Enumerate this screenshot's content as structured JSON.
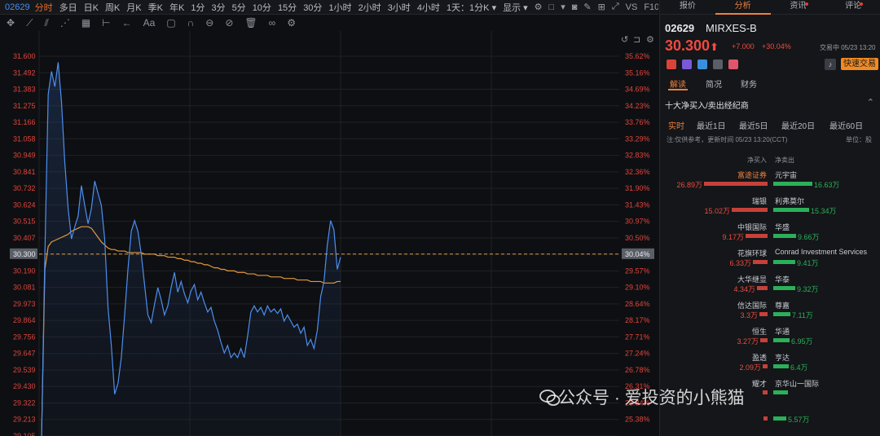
{
  "toolbar": {
    "code": "02629",
    "timeframes": [
      "分时",
      "多日",
      "日K",
      "周K",
      "月K",
      "季K",
      "年K",
      "1分",
      "3分",
      "5分",
      "10分",
      "15分",
      "30分",
      "1小时",
      "2小时",
      "3小时",
      "4小时"
    ],
    "active_timeframe": "分时",
    "dropdown": "1天：1分K",
    "display": "显示",
    "vs_label": "VS",
    "f10_label": "F10"
  },
  "drawbar": {
    "text_tool": "Aa"
  },
  "chart_data": {
    "type": "line",
    "price_ticks": [
      "31.600",
      "31.492",
      "31.383",
      "31.275",
      "31.166",
      "31.058",
      "30.949",
      "30.841",
      "30.732",
      "30.624",
      "30.515",
      "30.407",
      "30.300",
      "30.190",
      "30.081",
      "29.973",
      "29.864",
      "29.756",
      "29.647",
      "29.539",
      "29.430",
      "29.322",
      "29.213",
      "29.105"
    ],
    "pct_ticks": [
      "35.62%",
      "35.16%",
      "34.69%",
      "34.23%",
      "33.76%",
      "33.29%",
      "32.83%",
      "32.36%",
      "31.90%",
      "31.43%",
      "30.97%",
      "30.50%",
      "30.04%",
      "29.57%",
      "29.10%",
      "28.64%",
      "28.17%",
      "27.71%",
      "27.24%",
      "26.78%",
      "26.31%",
      "25.84%",
      "25.38%"
    ],
    "current_price": 30.3,
    "current_pct": "30.04%",
    "ylim": [
      29.105,
      31.6
    ],
    "series": [
      {
        "values": [
          29.1,
          30.3,
          31.35,
          31.5,
          31.4,
          31.56,
          31.3,
          30.9,
          30.6,
          30.4,
          30.48,
          30.55,
          30.75,
          30.62,
          30.5,
          30.6,
          30.78,
          30.7,
          30.62,
          30.4,
          29.95,
          29.7,
          29.38,
          29.45,
          29.62,
          29.9,
          30.2,
          30.45,
          30.52,
          30.45,
          30.3,
          30.1,
          29.9,
          29.85,
          29.97,
          30.08,
          30.0,
          29.9,
          29.96,
          30.08,
          30.18,
          30.05,
          30.12,
          30.04,
          29.98,
          30.06,
          30.1,
          30.0,
          30.05,
          29.98,
          29.92,
          29.95,
          29.86,
          29.8,
          29.72,
          29.65,
          29.7,
          29.62,
          29.65,
          29.62,
          29.68,
          29.62,
          29.76,
          29.92,
          29.96,
          29.92,
          29.95,
          29.9,
          29.96,
          29.92,
          29.94,
          29.91,
          29.94,
          29.86,
          29.9,
          29.86,
          29.82,
          29.84,
          29.78,
          29.82,
          29.7,
          29.74,
          29.68,
          29.8,
          30.02,
          30.12,
          30.36,
          30.52,
          30.46,
          30.2,
          30.28
        ]
      },
      {
        "values": [
          29.1,
          30.2,
          30.35,
          30.38,
          30.39,
          30.4,
          30.41,
          30.42,
          30.43,
          30.45,
          30.46,
          30.47,
          30.48,
          30.48,
          30.48,
          30.47,
          30.44,
          30.41,
          30.38,
          30.36,
          30.34,
          30.33,
          30.33,
          30.32,
          30.32,
          30.32,
          30.31,
          30.31,
          30.31,
          30.31,
          30.31,
          30.3,
          30.3,
          30.3,
          30.3,
          30.29,
          30.29,
          30.29,
          30.28,
          30.28,
          30.28,
          30.27,
          30.27,
          30.26,
          30.26,
          30.25,
          30.25,
          30.24,
          30.24,
          30.23,
          30.23,
          30.22,
          30.21,
          30.21,
          30.2,
          30.2,
          30.19,
          30.19,
          30.19,
          30.18,
          30.18,
          30.18,
          30.17,
          30.17,
          30.17,
          30.16,
          30.16,
          30.16,
          30.16,
          30.15,
          30.15,
          30.15,
          30.15,
          30.14,
          30.14,
          30.14,
          30.14,
          30.13,
          30.13,
          30.13,
          30.13,
          30.12,
          30.12,
          30.12,
          30.12,
          30.11,
          30.11,
          30.11,
          30.11,
          30.12,
          30.12
        ]
      }
    ]
  },
  "right_panel": {
    "tabs": [
      {
        "label": "报价",
        "active": false,
        "dot": false
      },
      {
        "label": "分析",
        "active": true,
        "dot": false
      },
      {
        "label": "资讯",
        "active": false,
        "dot": true
      },
      {
        "label": "评论",
        "active": false,
        "dot": true
      }
    ],
    "code": "02629",
    "name": "MIRXES-B",
    "price": "30.300",
    "arrow": "⬆",
    "change": "+7.000",
    "change_pct": "+30.04%",
    "status": "交易中 05/23 13:20",
    "quick_trade": "快速交易",
    "subtabs": [
      "解读",
      "简况",
      "财务"
    ],
    "section_title": "十大净买入/卖出经纪商",
    "periods": [
      "实时",
      "最近1日",
      "最近5日",
      "最近20日",
      "最近60日"
    ],
    "note": "注:仅供参考，更新时间 05/23 13:20(CCT)",
    "unit": "单位：股",
    "col_buy": "净买入",
    "col_sell": "净卖出",
    "brokers": [
      {
        "buy_name": "富途证券",
        "buy_val": "26.89万",
        "buy": 26.89,
        "sell_name": "元宇宙",
        "sell_val": "16.63万",
        "sell": 16.63,
        "highlight": true
      },
      {
        "buy_name": "瑞银",
        "buy_val": "15.02万",
        "buy": 15.02,
        "sell_name": "利弗莫尔",
        "sell_val": "15.34万",
        "sell": 15.34
      },
      {
        "buy_name": "中银国际",
        "buy_val": "9.17万",
        "buy": 9.17,
        "sell_name": "华盛",
        "sell_val": "9.66万",
        "sell": 9.66
      },
      {
        "buy_name": "花旗环球",
        "buy_val": "6.33万",
        "buy": 6.33,
        "sell_name": "Conrad Investment Services",
        "sell_val": "9.41万",
        "sell": 9.41
      },
      {
        "buy_name": "大华继显",
        "buy_val": "4.34万",
        "buy": 4.34,
        "sell_name": "华泰",
        "sell_val": "9.32万",
        "sell": 9.32
      },
      {
        "buy_name": "信达国际",
        "buy_val": "3.3万",
        "buy": 3.3,
        "sell_name": "尊嘉",
        "sell_val": "7.11万",
        "sell": 7.11
      },
      {
        "buy_name": "恒生",
        "buy_val": "3.27万",
        "buy": 3.27,
        "sell_name": "华通",
        "sell_val": "6.95万",
        "sell": 6.95
      },
      {
        "buy_name": "盈透",
        "buy_val": "2.09万",
        "buy": 2.09,
        "sell_name": "亨达",
        "sell_val": "6.4万",
        "sell": 6.4
      },
      {
        "buy_name": "耀才",
        "buy_val": "",
        "buy": 1.9,
        "sell_name": "京华山一国际",
        "sell_val": "",
        "sell": 6.2
      },
      {
        "buy_name": "",
        "buy_val": "",
        "buy": 1.6,
        "sell_name": "",
        "sell_val": "5.57万",
        "sell": 5.57
      }
    ]
  },
  "watermark": "公众号 · 爱投资的小熊猫",
  "colors": {
    "up": "#f04a3e",
    "down": "#2bb05a",
    "accent": "#f0803c",
    "line": "#4d8ff0",
    "avg": "#e39a3b"
  }
}
